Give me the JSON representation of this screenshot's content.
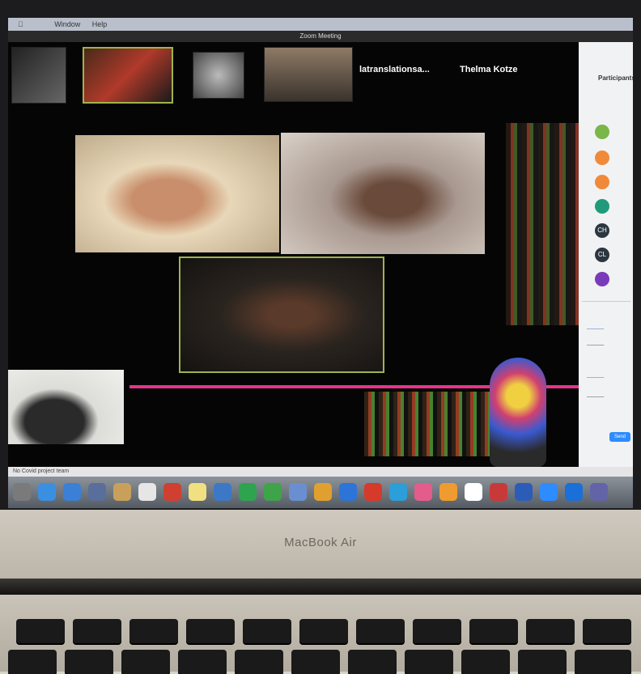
{
  "laptop": {
    "brand": "MacBook Air"
  },
  "os": {
    "menubar": [
      "",
      "",
      "Window",
      "Help"
    ],
    "window_title": "Zoom Meeting"
  },
  "meeting": {
    "participants_strip": [
      {
        "label": ""
      },
      {
        "label": ""
      },
      {
        "label": ""
      },
      {
        "label": ""
      },
      {
        "label": "latranslationsa..."
      },
      {
        "label": "Thelma Kotze"
      }
    ],
    "gallery_tiles": [
      "participant-1",
      "participant-2",
      "participant-3"
    ],
    "interpreter_tile": "sign-language-interpreter",
    "background_art": "painted-face-artwork"
  },
  "panel": {
    "title": "Participants",
    "avatars": [
      {
        "initials": "",
        "color": "#7ab648"
      },
      {
        "initials": "",
        "color": "#f08a3a"
      },
      {
        "initials": "",
        "color": "#f08a3a"
      },
      {
        "initials": "",
        "color": "#1f9a7a"
      },
      {
        "initials": "CH",
        "color": "#2a3640"
      },
      {
        "initials": "CL",
        "color": "#2a3640"
      },
      {
        "initials": "",
        "color": "#7a3bb8"
      }
    ],
    "send_button": "Send"
  },
  "infobar": {
    "left_text": "No Covid project team",
    "sub_text": ""
  },
  "dock": {
    "icon_colors": [
      "#7a7a7a",
      "#3b8fe0",
      "#3b7fd6",
      "#5a6e9c",
      "#c8a05c",
      "#e6e6e6",
      "#d04030",
      "#f0e080",
      "#3c78c6",
      "#2ea44f",
      "#3fa34a",
      "#6a8fd0",
      "#e0a030",
      "#2c74d8",
      "#d63a2a",
      "#2c9ed8",
      "#e45c8c",
      "#ef9b2f",
      "#ffffff",
      "#c83a3a",
      "#2b5cb8",
      "#2d8cff",
      "#1a6fd8",
      "#6264a7"
    ]
  },
  "colors": {
    "zoom_accent": "#2d8cff",
    "active_border": "#9fb34d",
    "neon": "#e8338a"
  }
}
